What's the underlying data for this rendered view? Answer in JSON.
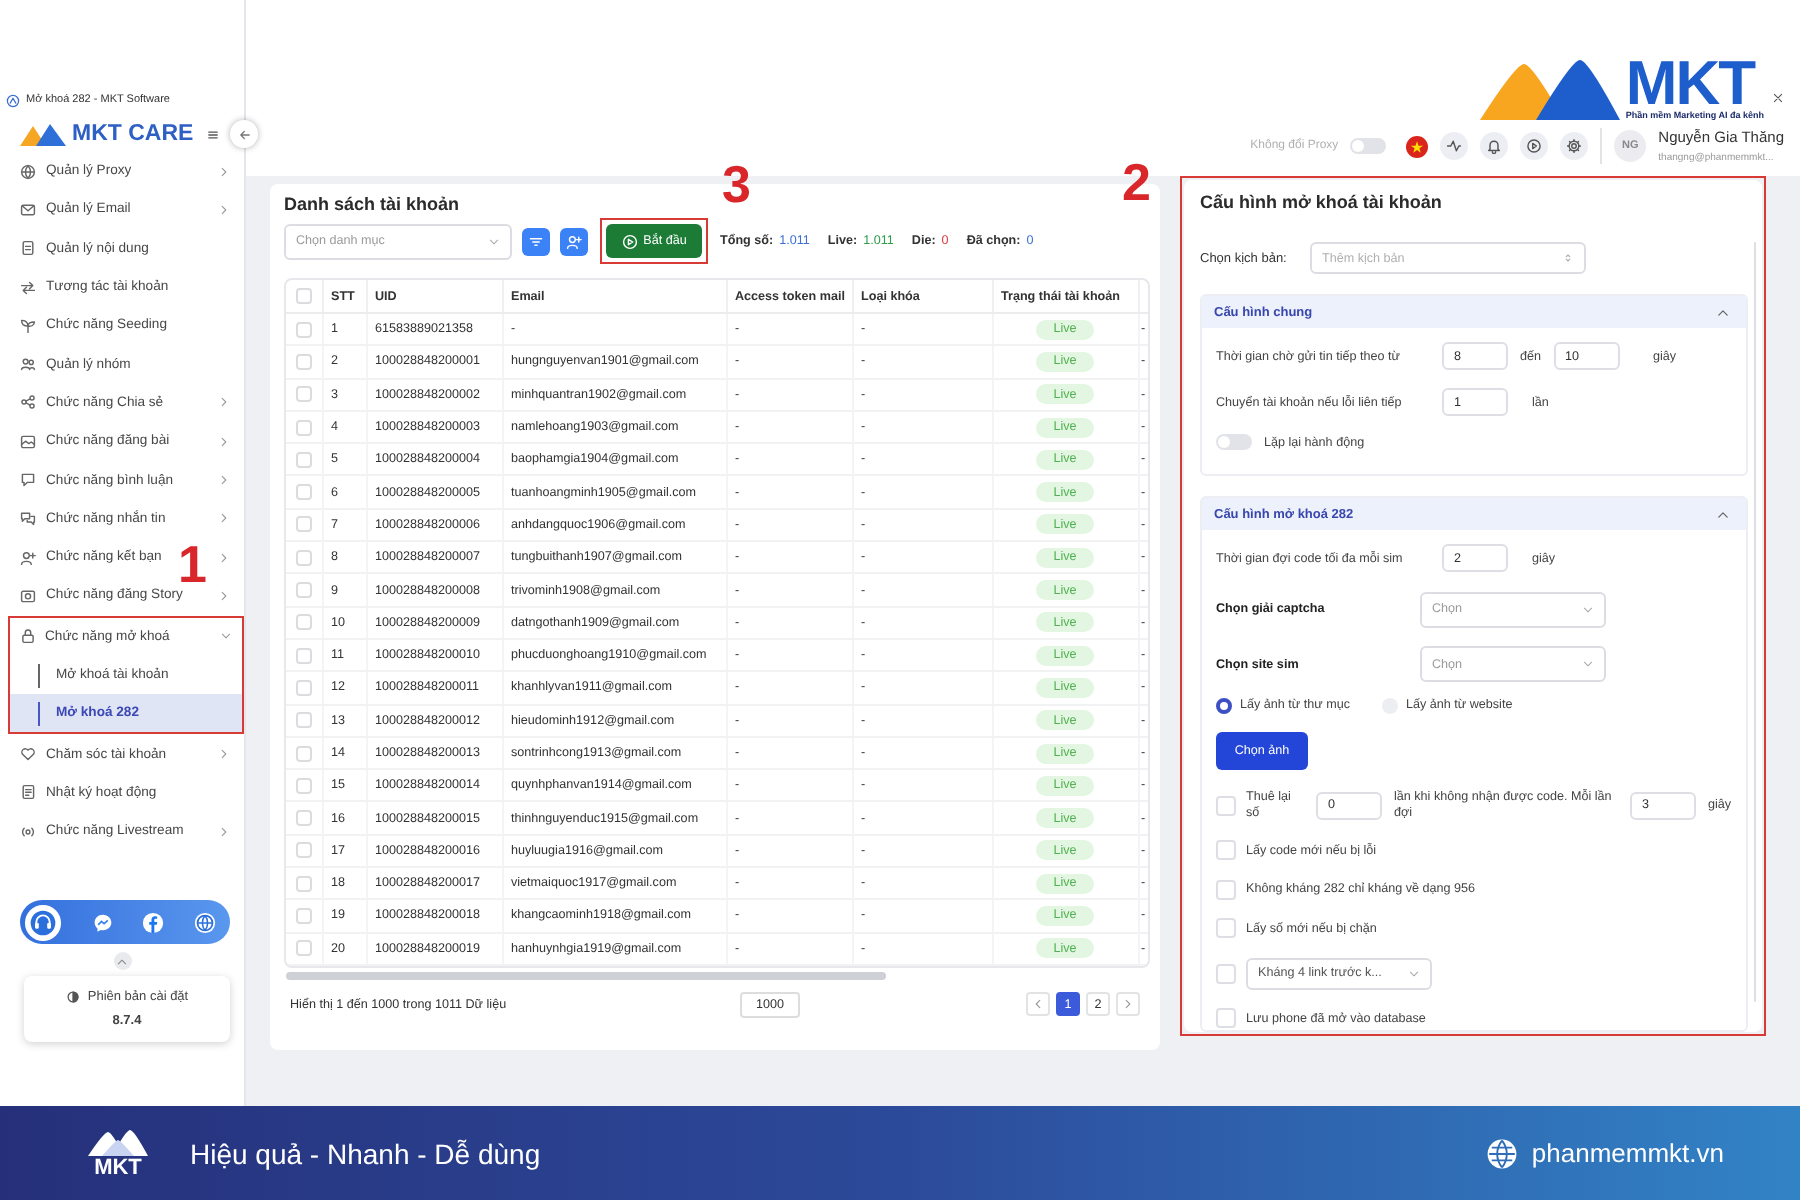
{
  "window": {
    "title": "Mở khoá 282 - MKT Software"
  },
  "brand": {
    "sidebar_logo": "MKT CARE",
    "corner_logo": "MKT",
    "corner_tagline": "Phần mềm Marketing AI đa kênh"
  },
  "top_bar": {
    "proxy_label": "Không đổi Proxy",
    "proxy_on": false,
    "user": {
      "initials": "NG",
      "name": "Nguyễn Gia Thăng",
      "email": "thangng@phanmemmkt..."
    }
  },
  "sidebar": {
    "items": [
      {
        "label": "Quản lý Proxy",
        "expandable": true,
        "selected": false
      },
      {
        "label": "Quản lý Email",
        "expandable": true,
        "selected": false
      },
      {
        "label": "Quản lý nội dung",
        "expandable": false,
        "selected": false
      },
      {
        "label": "Tương tác tài khoản",
        "expandable": false,
        "selected": false
      },
      {
        "label": "Chức năng Seeding",
        "expandable": false,
        "selected": false
      },
      {
        "label": "Quản lý nhóm",
        "expandable": false,
        "selected": false
      },
      {
        "label": "Chức năng Chia sẻ",
        "expandable": true,
        "selected": false
      },
      {
        "label": "Chức năng đăng bài",
        "expandable": true,
        "selected": false
      },
      {
        "label": "Chức năng bình luận",
        "expandable": true,
        "selected": false
      },
      {
        "label": "Chức năng nhắn tin",
        "expandable": true,
        "selected": false
      },
      {
        "label": "Chức năng kết bạn",
        "expandable": true,
        "selected": false
      },
      {
        "label": "Chức năng đăng Story",
        "expandable": true,
        "selected": false
      },
      {
        "label": "Chức năng mở khoá",
        "expandable": true,
        "expanded": true,
        "selected": false,
        "callout": "1",
        "children": [
          {
            "label": "Mở khoá tài khoản",
            "selected": false
          },
          {
            "label": "Mở khoá 282",
            "selected": true
          }
        ]
      },
      {
        "label": "Chăm sóc tài khoản",
        "expandable": true,
        "selected": false
      },
      {
        "label": "Nhật ký hoạt động",
        "expandable": false,
        "selected": false
      },
      {
        "label": "Chức năng Livestream",
        "expandable": true,
        "selected": false
      }
    ],
    "version_label": "Phiên bản cài đặt",
    "version": "8.7.4"
  },
  "account_list": {
    "title": "Danh sách tài khoản",
    "category_placeholder": "Chọn danh mục",
    "start_button": {
      "label": "Bắt đầu",
      "callout": "3"
    },
    "stats": [
      {
        "label": "Tổng số:",
        "value": "1.011",
        "color": "#3b6fd6"
      },
      {
        "label": "Live:",
        "value": "1.011",
        "color": "#2e9e4a"
      },
      {
        "label": "Die:",
        "value": "0",
        "color": "#e03a3a"
      },
      {
        "label": "Đã chọn:",
        "value": "0",
        "color": "#3b6fd6"
      }
    ],
    "table": {
      "all_checked": false,
      "columns": [
        {
          "label": "STT",
          "kind": "text"
        },
        {
          "label": "UID",
          "kind": "text"
        },
        {
          "label": "Email",
          "kind": "text"
        },
        {
          "label": "Access token mail",
          "kind": "text"
        },
        {
          "label": "Loại khóa",
          "kind": "text"
        },
        {
          "label": "Trạng thái tài khoản",
          "kind": "status"
        },
        {
          "kind": "text"
        }
      ],
      "rows": [
        {
          "checked": false,
          "cells": [
            "1",
            "61583889021358",
            "-",
            "-",
            "-",
            "Live",
            "-"
          ]
        },
        {
          "checked": false,
          "cells": [
            "2",
            "100028848200001",
            "hungnguyenvan1901@gmail.com",
            "-",
            "-",
            "Live",
            "-"
          ]
        },
        {
          "checked": false,
          "cells": [
            "3",
            "100028848200002",
            "minhquantran1902@gmail.com",
            "-",
            "-",
            "Live",
            "-"
          ]
        },
        {
          "checked": false,
          "cells": [
            "4",
            "100028848200003",
            "namlehoang1903@gmail.com",
            "-",
            "-",
            "Live",
            "-"
          ]
        },
        {
          "checked": false,
          "cells": [
            "5",
            "100028848200004",
            "baophamgia1904@gmail.com",
            "-",
            "-",
            "Live",
            "-"
          ]
        },
        {
          "checked": false,
          "cells": [
            "6",
            "100028848200005",
            "tuanhoangminh1905@gmail.com",
            "-",
            "-",
            "Live",
            "-"
          ]
        },
        {
          "checked": false,
          "cells": [
            "7",
            "100028848200006",
            "anhdangquoc1906@gmail.com",
            "-",
            "-",
            "Live",
            "-"
          ]
        },
        {
          "checked": false,
          "cells": [
            "8",
            "100028848200007",
            "tungbuithanh1907@gmail.com",
            "-",
            "-",
            "Live",
            "-"
          ]
        },
        {
          "checked": false,
          "cells": [
            "9",
            "100028848200008",
            "trivominh1908@gmail.com",
            "-",
            "-",
            "Live",
            "-"
          ]
        },
        {
          "checked": false,
          "cells": [
            "10",
            "100028848200009",
            "datngothanh1909@gmail.com",
            "-",
            "-",
            "Live",
            "-"
          ]
        },
        {
          "checked": false,
          "cells": [
            "11",
            "100028848200010",
            "phucduonghoang1910@gmail.com",
            "-",
            "-",
            "Live",
            "-"
          ]
        },
        {
          "checked": false,
          "cells": [
            "12",
            "100028848200011",
            "khanhlyvan1911@gmail.com",
            "-",
            "-",
            "Live",
            "-"
          ]
        },
        {
          "checked": false,
          "cells": [
            "13",
            "100028848200012",
            "hieudominh1912@gmail.com",
            "-",
            "-",
            "Live",
            "-"
          ]
        },
        {
          "checked": false,
          "cells": [
            "14",
            "100028848200013",
            "sontrinhcong1913@gmail.com",
            "-",
            "-",
            "Live",
            "-"
          ]
        },
        {
          "checked": false,
          "cells": [
            "15",
            "100028848200014",
            "quynhphanvan1914@gmail.com",
            "-",
            "-",
            "Live",
            "-"
          ]
        },
        {
          "checked": false,
          "cells": [
            "16",
            "100028848200015",
            "thinhnguyenduc1915@gmail.com",
            "-",
            "-",
            "Live",
            "-"
          ]
        },
        {
          "checked": false,
          "cells": [
            "17",
            "100028848200016",
            "huyluugia1916@gmail.com",
            "-",
            "-",
            "Live",
            "-"
          ]
        },
        {
          "checked": false,
          "cells": [
            "18",
            "100028848200017",
            "vietmaiquoc1917@gmail.com",
            "-",
            "-",
            "Live",
            "-"
          ]
        },
        {
          "checked": false,
          "cells": [
            "19",
            "100028848200018",
            "khangcaominh1918@gmail.com",
            "-",
            "-",
            "Live",
            "-"
          ]
        },
        {
          "checked": false,
          "cells": [
            "20",
            "100028848200019",
            "hanhuynhgia1919@gmail.com",
            "-",
            "-",
            "Live",
            "-"
          ]
        }
      ]
    },
    "footer": {
      "summary": "Hiển thị 1 đến 1000 trong 1011 Dữ liệu",
      "page_size": "1000",
      "pages": [
        {
          "label": "1",
          "selected": true
        },
        {
          "label": "2",
          "selected": false
        }
      ]
    }
  },
  "config_panel": {
    "title": "Cấu hình mở khoá tài khoản",
    "callout": "2",
    "script_label": "Chọn kịch bản:",
    "script_placeholder": "Thêm kịch bản",
    "sections": [
      {
        "title": "Cấu hình chung",
        "expanded": true,
        "fields": [
          {
            "kind": "range",
            "label": "Thời gian chờ gửi tin tiếp theo từ",
            "from": "8",
            "between": "đến",
            "to": "10",
            "unit": "giây"
          },
          {
            "kind": "number",
            "label": "Chuyển tài khoản nếu lỗi liên tiếp",
            "value": "1",
            "unit": "lần"
          },
          {
            "kind": "toggle",
            "label": "Lặp lại hành động",
            "on": false
          }
        ]
      },
      {
        "title": "Cấu hình mở khoá 282",
        "expanded": true,
        "fields": [
          {
            "kind": "number",
            "label": "Thời gian đợi code tối đa mỗi sim",
            "value": "2",
            "unit": "giây"
          },
          {
            "kind": "select",
            "label": "Chọn giải captcha",
            "placeholder": "Chọn"
          },
          {
            "kind": "select",
            "label": "Chọn site sim",
            "placeholder": "Chọn"
          },
          {
            "kind": "radio",
            "options": [
              {
                "label": "Lấy ảnh từ thư mục",
                "selected": true
              },
              {
                "label": "Lấy ảnh từ website",
                "selected": false
              }
            ]
          },
          {
            "kind": "button",
            "label": "Chọn ảnh"
          },
          {
            "kind": "retry",
            "checked": false,
            "label": "Thuê lại số",
            "count": "0",
            "middle": "lần khi không nhận được code. Mỗi lần đợi",
            "wait": "3",
            "unit": "giây"
          },
          {
            "kind": "checkbox",
            "label": "Lấy code mới nếu bị lỗi",
            "checked": false
          },
          {
            "kind": "checkbox",
            "label": "Không kháng 282 chỉ kháng về dạng 956",
            "checked": false
          },
          {
            "kind": "checkbox",
            "label": "Lấy số mới nếu bị chặn",
            "checked": false
          },
          {
            "kind": "checkbox-select",
            "checked": false,
            "value": "Kháng 4 link trước k..."
          },
          {
            "kind": "checkbox",
            "label": "Lưu phone đã mở vào database",
            "checked": false
          }
        ]
      }
    ]
  },
  "banner": {
    "logo": "MKT",
    "slogan": "Hiệu quả - Nhanh - Dễ dùng",
    "website": "phanmemmkt.vn"
  }
}
